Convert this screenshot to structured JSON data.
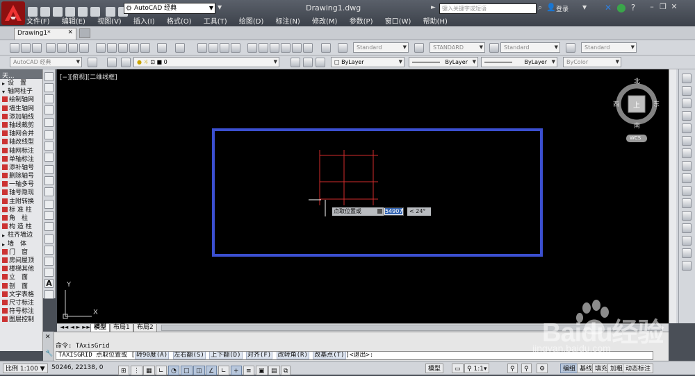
{
  "titlebar": {
    "workspace": "AutoCAD 经典",
    "document_title": "Drawing1.dwg",
    "search_placeholder": "键入关键字或短语",
    "login_label": "登录"
  },
  "menubar": [
    "文件(F)",
    "编辑(E)",
    "视图(V)",
    "插入(I)",
    "格式(O)",
    "工具(T)",
    "绘图(D)",
    "标注(N)",
    "修改(M)",
    "参数(P)",
    "窗口(W)",
    "帮助(H)"
  ],
  "tabs": {
    "active": "Drawing1*"
  },
  "toolbar1": {
    "text_style": "Standard",
    "dim_style": "STANDARD",
    "table_style": "Standard",
    "multileader_style": "Standard"
  },
  "toolbar2": {
    "workspace": "AutoCAD 经典",
    "layer": "0",
    "color": "ByLayer",
    "linetype": "ByLayer",
    "lineweight": "ByLayer",
    "plotstyle": "ByColor"
  },
  "left_panel": {
    "title": "天...",
    "items": [
      "设　置",
      "轴网柱子",
      "绘制轴网",
      "墙生轴网",
      "添加轴线",
      "轴线裁剪",
      "轴网合并",
      "轴改线型",
      "轴网标注",
      "单轴标注",
      "添补轴号",
      "删除轴号",
      "一轴多号",
      "轴号隐现",
      "主附转换",
      "标 准 柱",
      "角　柱",
      "构 造 柱",
      "柱齐墙边",
      "墙　体",
      "门　窗",
      "房间屋顶",
      "楼梯其他",
      "立　面",
      "剖　面",
      "文字表格",
      "尺寸标注",
      "符号标注",
      "图层控制"
    ]
  },
  "canvas": {
    "view_label": "[−][俯视][二维线框]",
    "viewcube": {
      "north": "北",
      "south": "南",
      "east": "东",
      "west": "西",
      "top": "上",
      "wcs": "WCS"
    },
    "prompt": "点取位置或",
    "input_value": "54907",
    "angle": "< 24°",
    "ucs_x": "X",
    "ucs_y": "Y"
  },
  "layout_tabs": [
    "模型",
    "布局1",
    "布局2"
  ],
  "command": {
    "history": "命令: TAxisGrid",
    "prefix": "TAXISGRID 点取位置或 [",
    "options": [
      "转90度(A)",
      "左右翻(S)",
      "上下翻(D)",
      "对齐(F)",
      "改转角(R)",
      "改基点(T)"
    ],
    "suffix": "]<退出>:"
  },
  "statusbar": {
    "scale": "比例 1:100",
    "coords": "50246, 22138, 0",
    "model": "模型",
    "annotation_scale": "1:1",
    "right_buttons": [
      "编组",
      "基线",
      "填充",
      "加粗",
      "动态标注"
    ]
  },
  "watermark": {
    "brand": "Baidu经验",
    "url": "jingyan.baidu.com"
  },
  "colors": {
    "canvas_bg": "#000000",
    "frame_blue": "#3b4fd0",
    "grid_red": "#d22b2b",
    "accent": "#c8181c"
  }
}
